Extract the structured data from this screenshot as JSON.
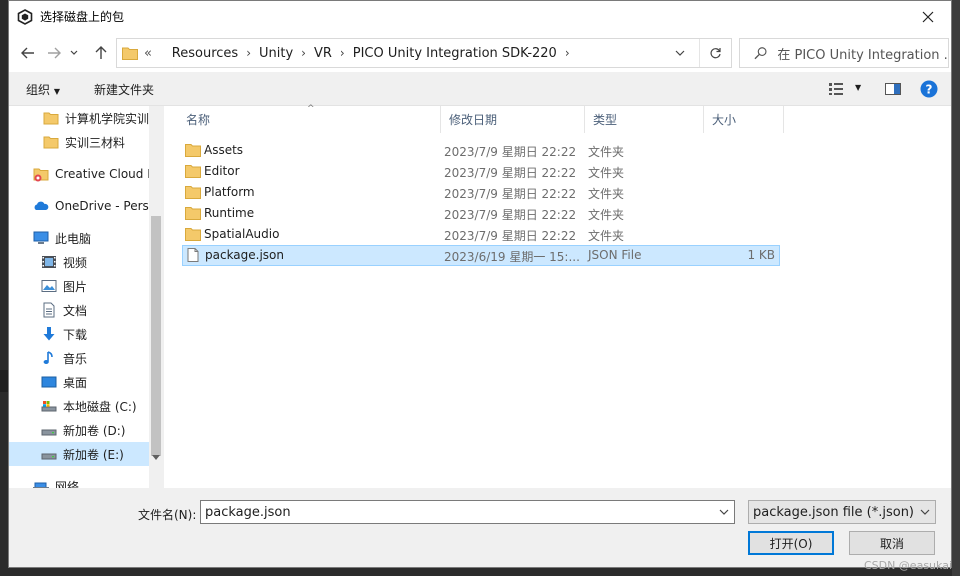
{
  "window": {
    "title": "选择磁盘上的包"
  },
  "nav": {
    "breadcrumbs": [
      "Resources",
      "Unity",
      "VR",
      "PICO Unity Integration SDK-220"
    ],
    "overflow": "«",
    "search_placeholder": "在 PICO Unity Integration ..."
  },
  "toolbar": {
    "organize": "组织",
    "new_folder": "新建文件夹"
  },
  "sidebar": {
    "items": [
      {
        "label": "计算机学院实训二",
        "icon": "folder-icon"
      },
      {
        "label": "实训三材料",
        "icon": "folder-icon"
      },
      {
        "label": "Creative Cloud F",
        "icon": "creative-cloud-icon"
      },
      {
        "label": "OneDrive - Perso",
        "icon": "onedrive-icon"
      },
      {
        "label": "此电脑",
        "icon": "pc-icon"
      },
      {
        "label": "视频",
        "icon": "videos-icon"
      },
      {
        "label": "图片",
        "icon": "pictures-icon"
      },
      {
        "label": "文档",
        "icon": "documents-icon"
      },
      {
        "label": "下载",
        "icon": "downloads-icon"
      },
      {
        "label": "音乐",
        "icon": "music-icon"
      },
      {
        "label": "桌面",
        "icon": "desktop-icon"
      },
      {
        "label": "本地磁盘 (C:)",
        "icon": "system-drive-icon"
      },
      {
        "label": "新加卷 (D:)",
        "icon": "drive-icon"
      },
      {
        "label": "新加卷 (E:)",
        "icon": "drive-icon"
      },
      {
        "label": "网络",
        "icon": "network-icon"
      }
    ]
  },
  "columns": {
    "name": "名称",
    "date": "修改日期",
    "type": "类型",
    "size": "大小"
  },
  "files": [
    {
      "name": "Assets",
      "date": "2023/7/9 星期日 22:22",
      "type": "文件夹",
      "size": "",
      "kind": "folder"
    },
    {
      "name": "Editor",
      "date": "2023/7/9 星期日 22:22",
      "type": "文件夹",
      "size": "",
      "kind": "folder"
    },
    {
      "name": "Platform",
      "date": "2023/7/9 星期日 22:22",
      "type": "文件夹",
      "size": "",
      "kind": "folder"
    },
    {
      "name": "Runtime",
      "date": "2023/7/9 星期日 22:22",
      "type": "文件夹",
      "size": "",
      "kind": "folder"
    },
    {
      "name": "SpatialAudio",
      "date": "2023/7/9 星期日 22:22",
      "type": "文件夹",
      "size": "",
      "kind": "folder"
    },
    {
      "name": "package.json",
      "date": "2023/6/19 星期一 15:...",
      "type": "JSON File",
      "size": "1 KB",
      "kind": "file"
    }
  ],
  "bottom": {
    "filename_label": "文件名(N):",
    "filename_value": "package.json",
    "filetype_value": "package.json file (*.json)",
    "open_button": "打开(O)",
    "cancel_button": "取消"
  },
  "watermark": "CSDN @easukai"
}
